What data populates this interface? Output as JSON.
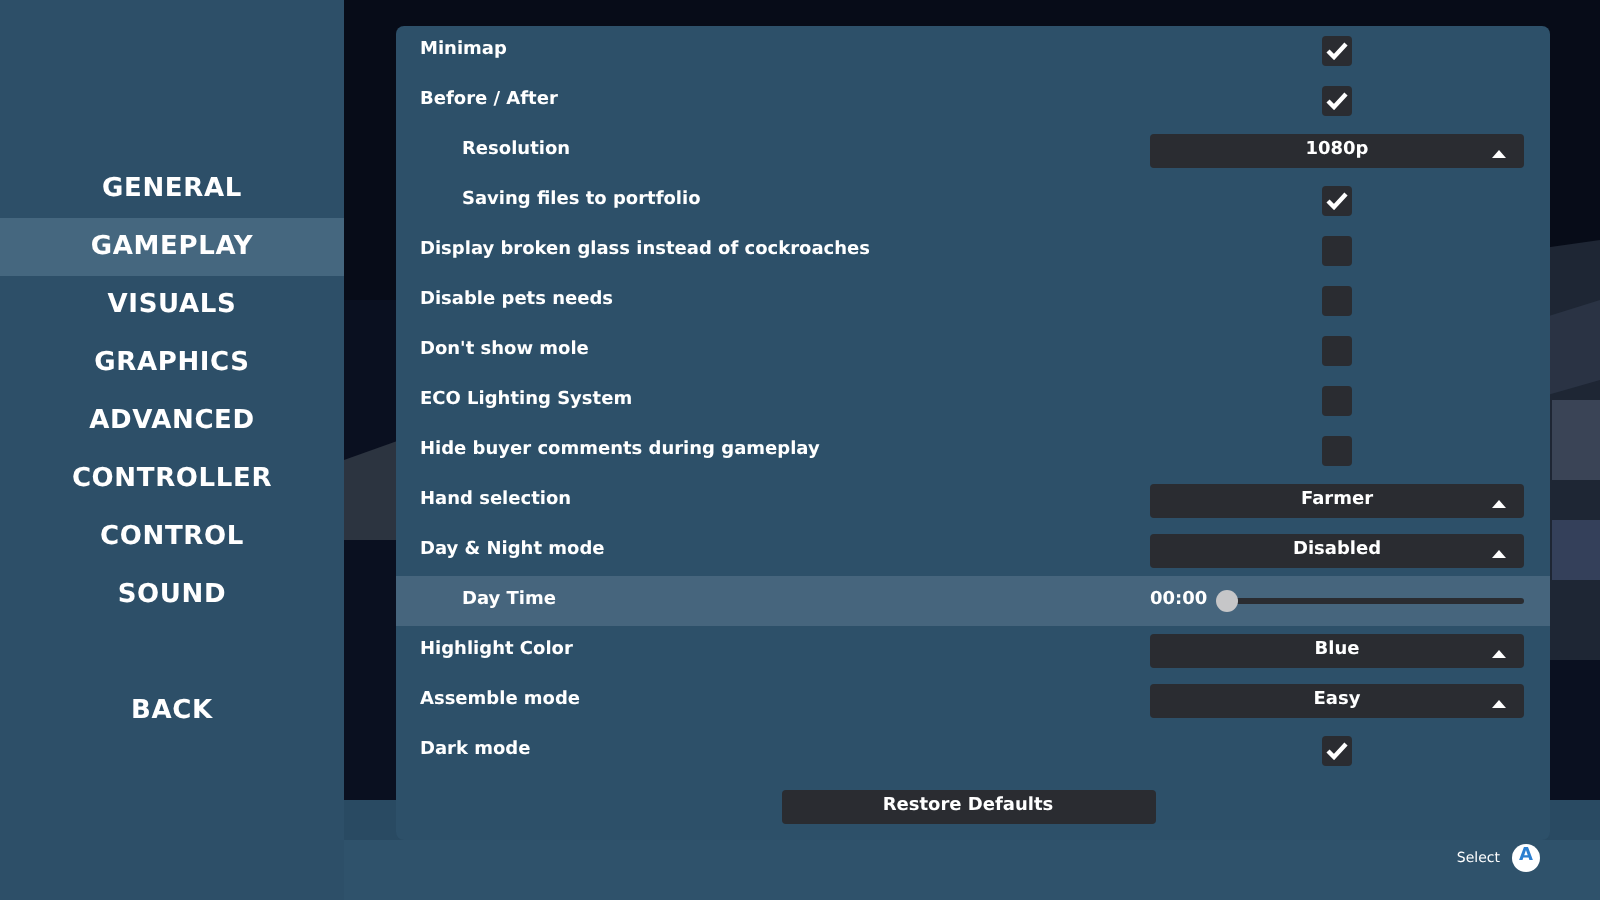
{
  "sidebar": {
    "items": [
      {
        "label": "GENERAL",
        "selected": false
      },
      {
        "label": "GAMEPLAY",
        "selected": true
      },
      {
        "label": "VISUALS",
        "selected": false
      },
      {
        "label": "GRAPHICS",
        "selected": false
      },
      {
        "label": "ADVANCED",
        "selected": false
      },
      {
        "label": "CONTROLLER",
        "selected": false
      },
      {
        "label": "CONTROL",
        "selected": false
      },
      {
        "label": "SOUND",
        "selected": false
      }
    ],
    "back": "BACK"
  },
  "settings": [
    {
      "label": "Minimap",
      "kind": "checkbox",
      "checked": true,
      "selected": false
    },
    {
      "label": "Before / After",
      "kind": "checkbox",
      "checked": true,
      "selected": false,
      "children": [
        {
          "label": "Resolution",
          "kind": "dropdown",
          "value": "1080p",
          "selected": false
        },
        {
          "label": "Saving files to portfolio",
          "kind": "checkbox",
          "checked": true,
          "selected": false
        }
      ]
    },
    {
      "label": "Display broken glass instead of cockroaches",
      "kind": "checkbox",
      "checked": false,
      "selected": false
    },
    {
      "label": "Disable pets needs",
      "kind": "checkbox",
      "checked": false,
      "selected": false
    },
    {
      "label": "Don't show mole",
      "kind": "checkbox",
      "checked": false,
      "selected": false
    },
    {
      "label": "ECO Lighting System",
      "kind": "checkbox",
      "checked": false,
      "selected": false
    },
    {
      "label": "Hide buyer comments during gameplay",
      "kind": "checkbox",
      "checked": false,
      "selected": false
    },
    {
      "label": "Hand selection",
      "kind": "dropdown",
      "value": "Farmer",
      "selected": false
    },
    {
      "label": "Day & Night mode",
      "kind": "dropdown",
      "value": "Disabled",
      "selected": false,
      "children": [
        {
          "label": "Day Time",
          "kind": "slider",
          "reading": "00:00",
          "level": 0,
          "selected": true
        }
      ]
    },
    {
      "label": "Highlight Color",
      "kind": "dropdown",
      "value": "Blue",
      "selected": false
    },
    {
      "label": "Assemble mode",
      "kind": "dropdown",
      "value": "Easy",
      "selected": false
    },
    {
      "label": "Dark mode",
      "kind": "checkbox",
      "checked": true,
      "selected": false
    }
  ],
  "restore_button": "Restore Defaults",
  "footer": {
    "hint": "Select",
    "button": "A"
  }
}
